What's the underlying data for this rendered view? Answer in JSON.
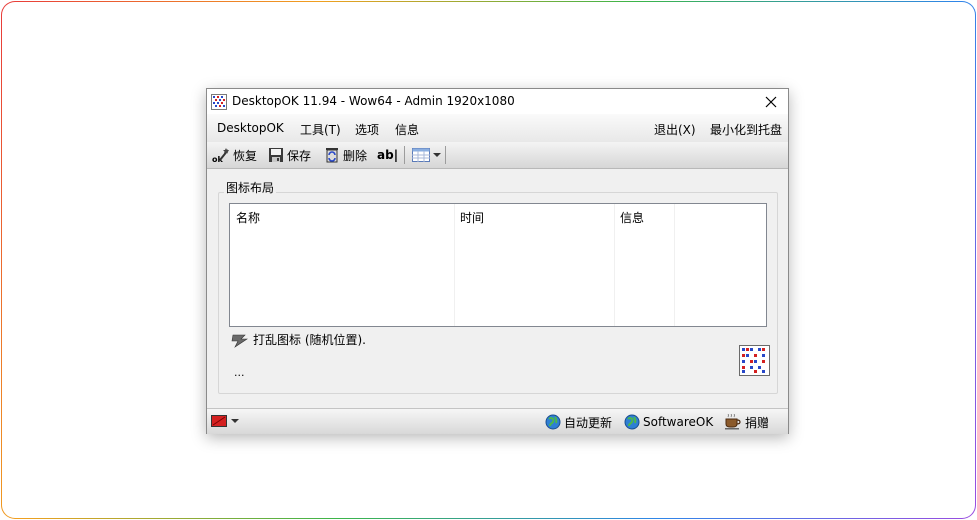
{
  "window": {
    "title": "DesktopOK 11.94 - Wow64 - Admin 1920x1080"
  },
  "menu": {
    "left": [
      "DesktopOK",
      "工具(T)",
      "选项",
      "信息"
    ],
    "exit": "退出(X)",
    "minimize_tray": "最小化到托盘"
  },
  "toolbar": {
    "restore": "恢复",
    "save": "保存",
    "delete": "删除",
    "rename": "ab|"
  },
  "layout_group": {
    "label": "图标布局",
    "columns": [
      "名称",
      "时间",
      "信息",
      ""
    ]
  },
  "shuffle_text": "打乱图标 (随机位置).",
  "ellipsis": "...",
  "statusbar": {
    "auto_update": "自动更新",
    "softwareok": "SoftwareOK",
    "donate": "捐赠"
  },
  "colors": {
    "accent_red": "#d42020",
    "logo_blue": "#2848c8"
  }
}
